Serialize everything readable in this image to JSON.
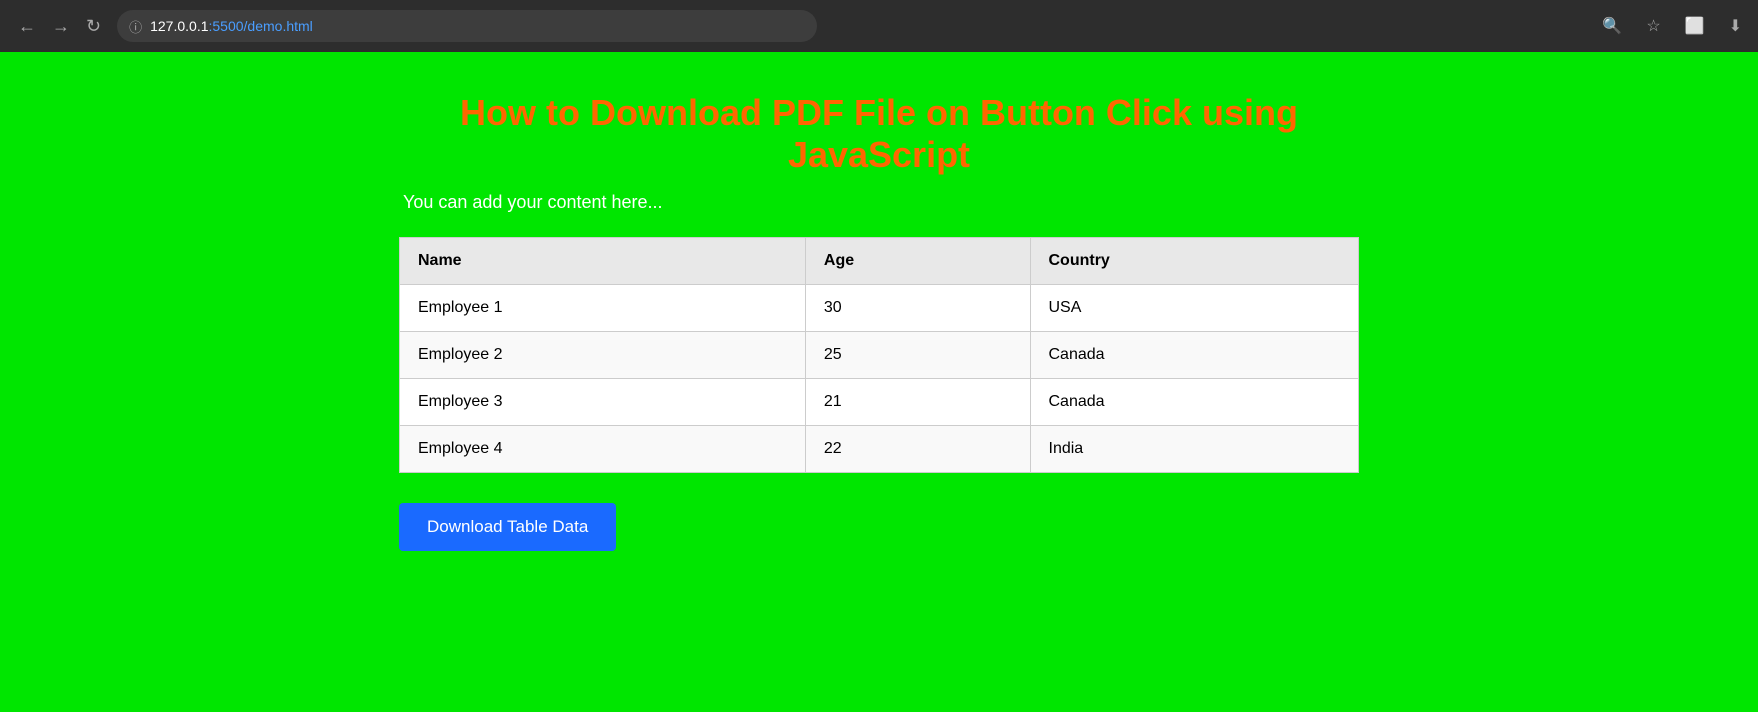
{
  "browser": {
    "url": "127.0.0.1",
    "port_path": ":5500/demo.html",
    "back_label": "←",
    "forward_label": "→",
    "reload_label": "↻"
  },
  "page": {
    "title": "How to Download PDF File on Button Click using JavaScript",
    "subtitle": "You can add your content here...",
    "download_button_label": "Download Table Data"
  },
  "table": {
    "headers": [
      "Name",
      "Age",
      "Country"
    ],
    "rows": [
      {
        "name": "Employee 1",
        "age": "30",
        "country": "USA"
      },
      {
        "name": "Employee 2",
        "age": "25",
        "country": "Canada"
      },
      {
        "name": "Employee 3",
        "age": "21",
        "country": "Canada"
      },
      {
        "name": "Employee 4",
        "age": "22",
        "country": "India"
      }
    ]
  }
}
